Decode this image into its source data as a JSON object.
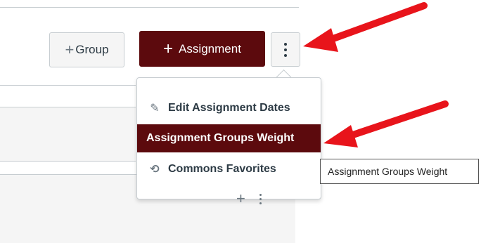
{
  "toolbar": {
    "group_button_plus": "+",
    "group_button_label": "Group",
    "assignment_button_plus": "+",
    "assignment_button_label": "Assignment",
    "more_button_icon": "vertical-ellipsis-icon"
  },
  "menu": {
    "items": [
      {
        "label": "Edit Assignment Dates",
        "icon": "pencil-icon",
        "glyph": "✎"
      },
      {
        "label": "Assignment Groups Weight",
        "highlighted": true
      },
      {
        "label": "Commons Favorites",
        "icon": "commons-icon",
        "glyph": "⟲"
      }
    ]
  },
  "tooltip": {
    "text": "Assignment Groups Weight"
  },
  "group_row": {
    "add_icon": "+",
    "more_icon": "vertical-ellipsis-icon"
  },
  "colors": {
    "brand": "#5c0a0d",
    "border": "#c7cdd1",
    "arrow": "#e8141b"
  }
}
